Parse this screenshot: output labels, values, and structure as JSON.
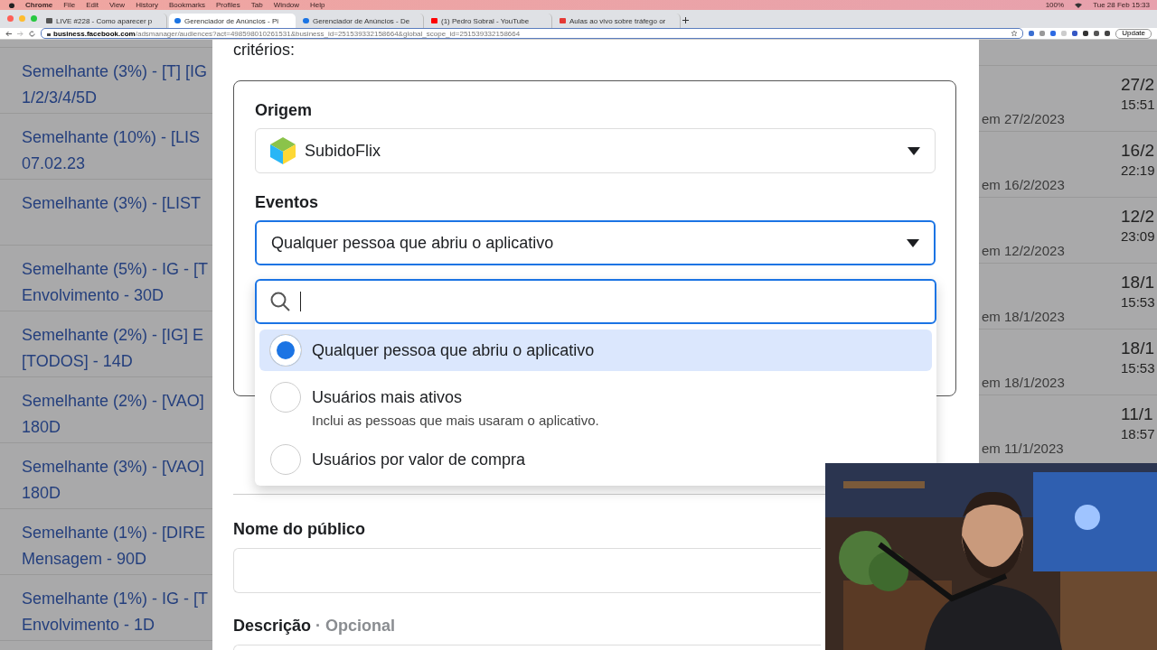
{
  "menu_bar": {
    "app": "Chrome",
    "items": [
      "File",
      "Edit",
      "View",
      "History",
      "Bookmarks",
      "Profiles",
      "Tab",
      "Window",
      "Help"
    ],
    "battery": "100%",
    "clock": "Tue 28 Feb 15:33"
  },
  "tabs": [
    {
      "title": "LIVE #228 - Como aparecer p",
      "selected": false,
      "kind": "web"
    },
    {
      "title": "Gerenciador de Anúncios - Pi",
      "selected": true,
      "kind": "meta"
    },
    {
      "title": "Gerenciador de Anúncios - De",
      "selected": false,
      "kind": "meta"
    },
    {
      "title": "(1) Pedro Sobral - YouTube",
      "selected": false,
      "kind": "video"
    },
    {
      "title": "Aulas ao vivo sobre tráfego or",
      "selected": false,
      "kind": "doc"
    }
  ],
  "address_bar": {
    "host": "business.facebook.com",
    "path": "/adsmanager/audiences?act=498598010261531&business_id=251539332158664&global_scope_id=251539332158664",
    "update": "Update"
  },
  "audience_list": [
    {
      "lines": [
        "Semelhante (3%) - [T] [IG",
        "1/2/3/4/5D"
      ]
    },
    {
      "lines": [
        "Semelhante (10%) - [LIS",
        "07.02.23"
      ]
    },
    {
      "lines": [
        "Semelhante (3%) - [LIST"
      ]
    },
    {
      "lines": [
        "Semelhante (5%) - IG - [T",
        "Envolvimento - 30D"
      ]
    },
    {
      "lines": [
        "Semelhante (2%) - [IG] E",
        "[TODOS] - 14D"
      ]
    },
    {
      "lines": [
        "Semelhante (2%) - [VAO]",
        "180D"
      ]
    },
    {
      "lines": [
        "Semelhante (3%) - [VAO]",
        "180D"
      ]
    },
    {
      "lines": [
        "Semelhante (1%) - [DIRE",
        "Mensagem - 90D"
      ]
    },
    {
      "lines": [
        "Semelhante (1%) - IG - [T",
        "Envolvimento - 1D"
      ]
    }
  ],
  "created_list": [
    {
      "note": "em 27/2/2023",
      "date": "27/2",
      "time": "15:51"
    },
    {
      "note": "em 16/2/2023",
      "date": "16/2",
      "time": "22:19"
    },
    {
      "note": "em 12/2/2023",
      "date": "12/2",
      "time": "23:09"
    },
    {
      "note": "em 18/1/2023",
      "date": "18/1",
      "time": "15:53"
    },
    {
      "note": "em 18/1/2023",
      "date": "18/1",
      "time": "15:53"
    },
    {
      "note": "em 11/1/2023",
      "date": "11/1",
      "time": "18:57"
    }
  ],
  "modal": {
    "intro": "critérios:",
    "origin": {
      "label": "Origem",
      "value": "SubidoFlix"
    },
    "events": {
      "label": "Eventos",
      "value": "Qualquer pessoa que abriu o aplicativo"
    },
    "options": [
      {
        "label": "Qualquer pessoa que abriu o aplicativo",
        "selected": true
      },
      {
        "label": "Usuários mais ativos",
        "description": "Inclui as pessoas que mais usaram o aplicativo.",
        "selected": false
      },
      {
        "label": "Usuários por valor de compra",
        "selected": false
      }
    ],
    "name_label": "Nome do público",
    "description_label": "Descrição",
    "separator": "·",
    "description_hint": "Opcional"
  }
}
